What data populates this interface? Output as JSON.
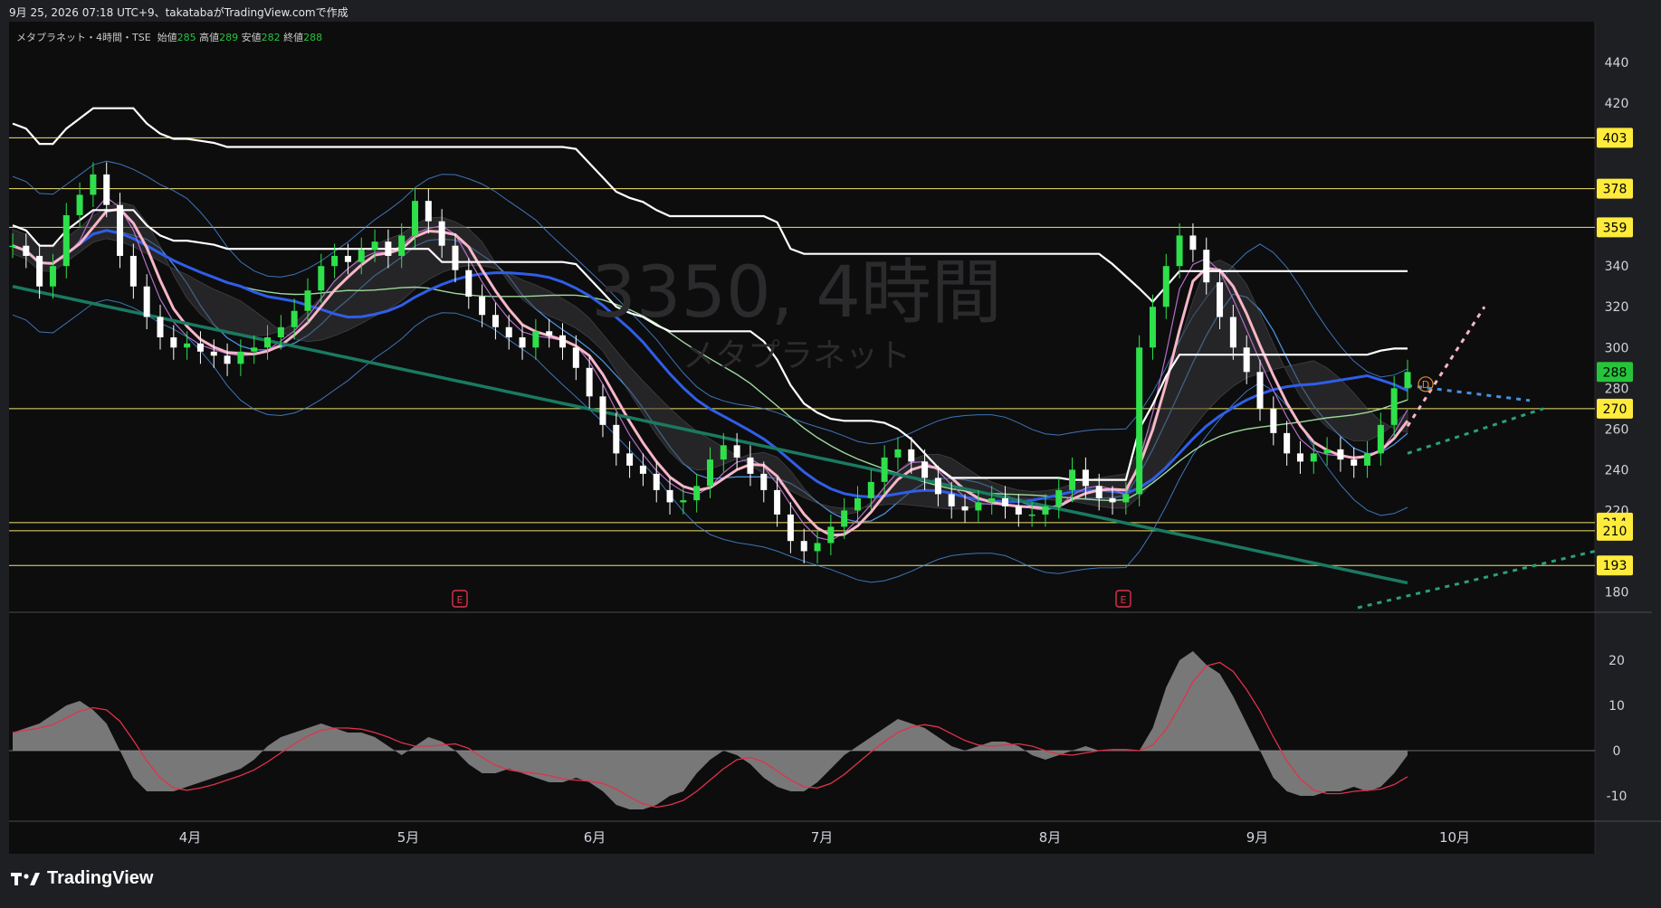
{
  "header": {
    "date_line": "9月 25, 2026 07:18 UTC+9、takatabaがTradingView.comで作成"
  },
  "legend": {
    "symbol": "メタプラネット・4時間・TSE",
    "open_label": "始値",
    "open": "285",
    "high_label": "高値",
    "high": "289",
    "low_label": "安値",
    "low": "282",
    "close_label": "終値",
    "close": "288"
  },
  "watermark": {
    "line1": "3350, 4時間",
    "line2": "メタプラネット"
  },
  "footer": {
    "brand": "TradingView"
  },
  "colors": {
    "background": "#0d0d0e",
    "frame": "#1e1f22",
    "up_candle": "#2ee04a",
    "down_candle": "#ffffff",
    "pink_line": "#f7b6c8",
    "blue_line": "#2f5ee8",
    "light_blue": "#4a8fe0",
    "green_ma": "#9ed89a",
    "dark_green": "#1a7a60",
    "level_line": "#f4e36a",
    "label_yellow": "#ffeb3b",
    "label_green": "#26c43a",
    "osc_fill": "#8c8c8c",
    "osc_signal": "#e0324a"
  },
  "chart_data": [
    {
      "type": "candlestick",
      "ylim": [
        170,
        460
      ],
      "y_ticks": [
        "180",
        "220",
        "240",
        "260",
        "280",
        "300",
        "320",
        "340",
        "420",
        "440"
      ],
      "x_ticks": [
        "4月",
        "5月",
        "6月",
        "7月",
        "8月",
        "9月",
        "10月"
      ],
      "horizontal_levels": [
        {
          "value": 403,
          "label": "403"
        },
        {
          "value": 378,
          "label": "378"
        },
        {
          "value": 359,
          "label": "359"
        },
        {
          "value": 270,
          "label": "270"
        },
        {
          "value": 214,
          "label": "214"
        },
        {
          "value": 210,
          "label": "210"
        },
        {
          "value": 193,
          "label": "193"
        }
      ],
      "last_price": {
        "value": 288,
        "label": "288"
      },
      "earnings_markers": [
        "E",
        "E"
      ],
      "dividend_marker": "D",
      "close_path": [
        350,
        345,
        330,
        340,
        365,
        375,
        385,
        370,
        345,
        330,
        315,
        305,
        300,
        302,
        298,
        296,
        292,
        298,
        300,
        305,
        310,
        318,
        328,
        340,
        345,
        342,
        348,
        352,
        345,
        355,
        372,
        362,
        350,
        338,
        325,
        316,
        310,
        305,
        300,
        308,
        306,
        300,
        290,
        276,
        262,
        248,
        242,
        238,
        230,
        224,
        225,
        232,
        245,
        252,
        246,
        238,
        230,
        218,
        205,
        200,
        204,
        212,
        220,
        226,
        234,
        246,
        250,
        244,
        236,
        228,
        222,
        220,
        224,
        226,
        222,
        218,
        218,
        222,
        230,
        240,
        232,
        226,
        224,
        228,
        300,
        320,
        340,
        355,
        348,
        332,
        315,
        300,
        288,
        270,
        258,
        248,
        244,
        248,
        250,
        245,
        242,
        248,
        262,
        280,
        288
      ]
    },
    {
      "type": "area",
      "name": "oscillator",
      "ylim": [
        -15,
        28
      ],
      "y_ticks": [
        "20",
        "10",
        "0",
        "-10"
      ],
      "values": [
        4,
        5,
        6,
        8,
        10,
        11,
        9,
        6,
        0,
        -6,
        -9,
        -9,
        -9,
        -8,
        -7,
        -6,
        -5,
        -4,
        -2,
        1,
        3,
        4,
        5,
        6,
        5,
        4,
        4,
        3,
        1,
        -1,
        1,
        3,
        2,
        0,
        -3,
        -5,
        -5,
        -4,
        -5,
        -6,
        -7,
        -7,
        -6,
        -7,
        -9,
        -12,
        -13,
        -13,
        -12,
        -10,
        -9,
        -5,
        -2,
        0,
        -1,
        -3,
        -6,
        -8,
        -9,
        -9,
        -7,
        -4,
        -1,
        1,
        3,
        5,
        7,
        6,
        5,
        3,
        1,
        0,
        1,
        2,
        2,
        1,
        -1,
        -2,
        -1,
        0,
        1,
        0,
        0,
        0,
        0,
        5,
        14,
        20,
        22,
        19,
        17,
        12,
        6,
        0,
        -6,
        -9,
        -10,
        -10,
        -9,
        -9,
        -8,
        -9,
        -8,
        -5,
        -1
      ]
    }
  ]
}
